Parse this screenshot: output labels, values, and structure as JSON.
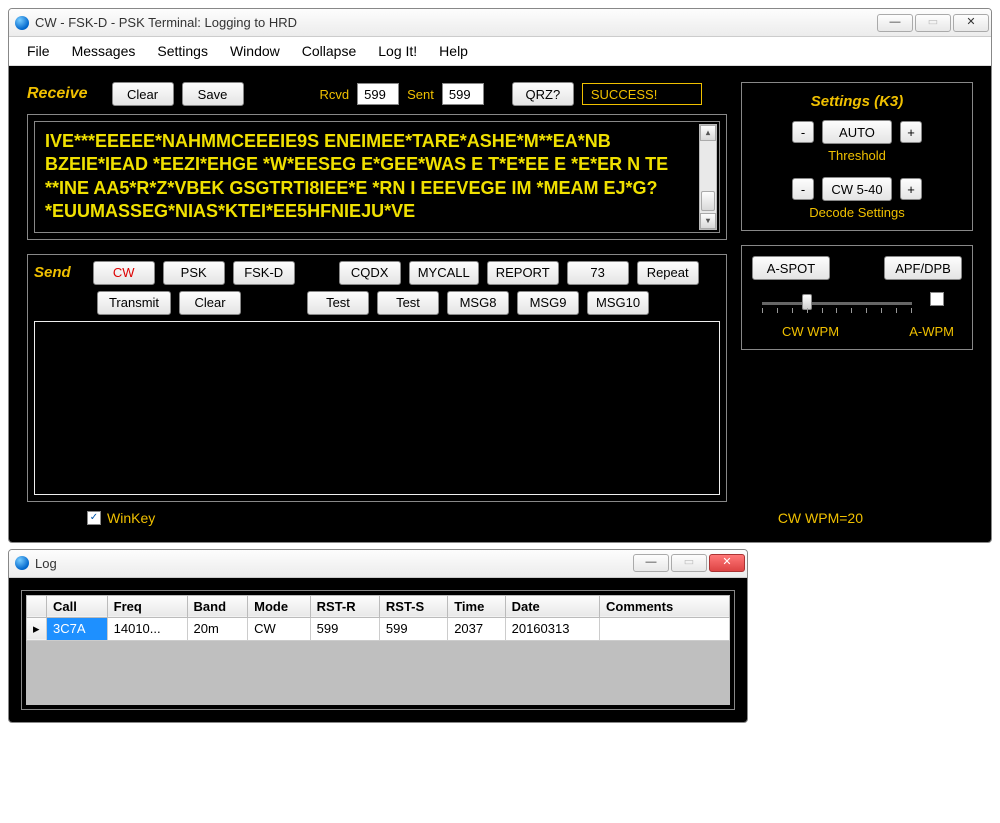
{
  "main_window": {
    "title": "CW - FSK-D - PSK Terminal: Logging to HRD",
    "menu": [
      "File",
      "Messages",
      "Settings",
      "Window",
      "Collapse",
      "Log It!",
      "Help"
    ],
    "receive": {
      "label": "Receive",
      "clear": "Clear",
      "save": "Save",
      "rcvd_label": "Rcvd",
      "rcvd_value": "599",
      "sent_label": "Sent",
      "sent_value": "599",
      "qrz": "QRZ?",
      "status": "SUCCESS!",
      "text": "IVE***EEEEE*NAHMMCEEEIE9S ENEIMEE*TARE*ASHE*M**EA*NB BZEIE*IEAD *EEZI*EHGE *W*EESEG E*GEE*WAS E T*E*EE E *E*ER N TE **INE AA5*R*Z*VBEK GSGTRTI8IEE*E *RN I EEEVEGE IM *MEAM EJ*G?*EUUMASSEG*NIAS*KTEI*EE5HFNIEJU*VE"
    },
    "send": {
      "label": "Send",
      "modes": {
        "cw": "CW",
        "psk": "PSK",
        "fskd": "FSK-D"
      },
      "macros_row1": [
        "CQDX",
        "MYCALL",
        "REPORT",
        "73",
        "Repeat"
      ],
      "transmit": "Transmit",
      "clear": "Clear",
      "macros_row2": [
        "Test",
        "Test",
        "MSG8",
        "MSG9",
        "MSG10"
      ]
    },
    "settings_panel": {
      "title": "Settings (K3)",
      "minus": "-",
      "plus": "+",
      "threshold_btn": "AUTO",
      "threshold_label": "Threshold",
      "decode_btn": "CW 5-40",
      "decode_label": "Decode Settings"
    },
    "right_panel": {
      "aspot": "A-SPOT",
      "apf": "APF/DPB",
      "cw_wpm": "CW WPM",
      "a_wpm": "A-WPM"
    },
    "footer": {
      "winkey": "WinKey",
      "wpm": "CW WPM=20"
    }
  },
  "log_window": {
    "title": "Log",
    "columns": [
      "Call",
      "Freq",
      "Band",
      "Mode",
      "RST-R",
      "RST-S",
      "Time",
      "Date",
      "Comments"
    ],
    "rows": [
      {
        "call": "3C7A",
        "freq": "14010...",
        "band": "20m",
        "mode": "CW",
        "rstr": "599",
        "rsts": "599",
        "time": "2037",
        "date": "20160313",
        "comments": ""
      }
    ]
  }
}
